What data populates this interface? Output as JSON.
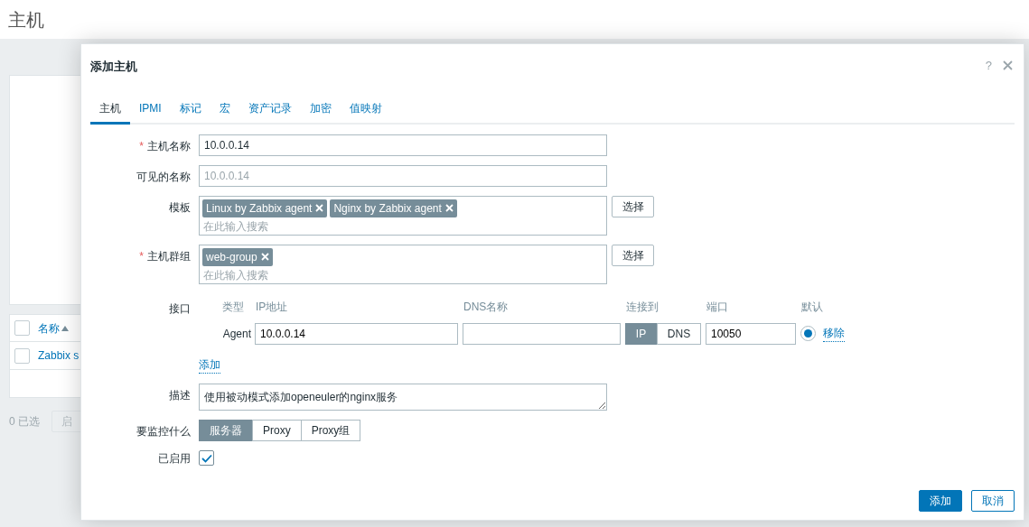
{
  "page": {
    "title": "主机"
  },
  "table": {
    "header_checked": false,
    "columns": [
      {
        "label": "名称",
        "sorted": true
      }
    ],
    "rows": [
      {
        "name": "Zabbix s",
        "checked": false
      }
    ],
    "selected_count": "0 已选",
    "buttons": [
      "启"
    ]
  },
  "dialog": {
    "title": "添加主机",
    "help": "?",
    "tabs": [
      {
        "label": "主机",
        "selected": true
      },
      {
        "label": "IPMI",
        "selected": false
      },
      {
        "label": "标记",
        "selected": false
      },
      {
        "label": "宏",
        "selected": false
      },
      {
        "label": "资产记录",
        "selected": false
      },
      {
        "label": "加密",
        "selected": false
      },
      {
        "label": "值映射",
        "selected": false
      }
    ],
    "host_name": {
      "label": "主机名称",
      "required_mark": "*",
      "value": "10.0.0.14"
    },
    "visible_name": {
      "label": "可见的名称",
      "placeholder": "10.0.0.14"
    },
    "templates": {
      "label": "模板",
      "tags": [
        "Linux by Zabbix agent",
        "Nginx by Zabbix agent"
      ],
      "placeholder": "在此输入搜索",
      "button": "选择"
    },
    "host_groups": {
      "label": "主机群组",
      "required_mark": "*",
      "tags": [
        "web-group"
      ],
      "placeholder": "在此输入搜索",
      "button": "选择"
    },
    "interfaces": {
      "label": "接口",
      "columns": [
        "类型",
        "IP地址",
        "DNS名称",
        "连接到",
        "端口",
        "默认"
      ],
      "rows": [
        {
          "type": "Agent",
          "ip": "10.0.0.14",
          "connect_options": [
            {
              "label": "IP",
              "selected": true
            },
            {
              "label": "DNS",
              "selected": false
            }
          ],
          "port": "10050",
          "default": true,
          "remove": "移除"
        }
      ],
      "add": "添加"
    },
    "description": {
      "label": "描述",
      "value": "使用被动模式添加openeuler的nginx服务"
    },
    "monitored_by": {
      "label": "要监控什么",
      "options": [
        {
          "label": "服务器",
          "selected": true
        },
        {
          "label": "Proxy",
          "selected": false
        },
        {
          "label": "Proxy组",
          "selected": false
        }
      ]
    },
    "enabled": {
      "label": "已启用",
      "checked": true
    },
    "buttons": [
      {
        "label": "添加",
        "kind": "primary"
      },
      {
        "label": "取消",
        "kind": "secondary"
      }
    ]
  }
}
